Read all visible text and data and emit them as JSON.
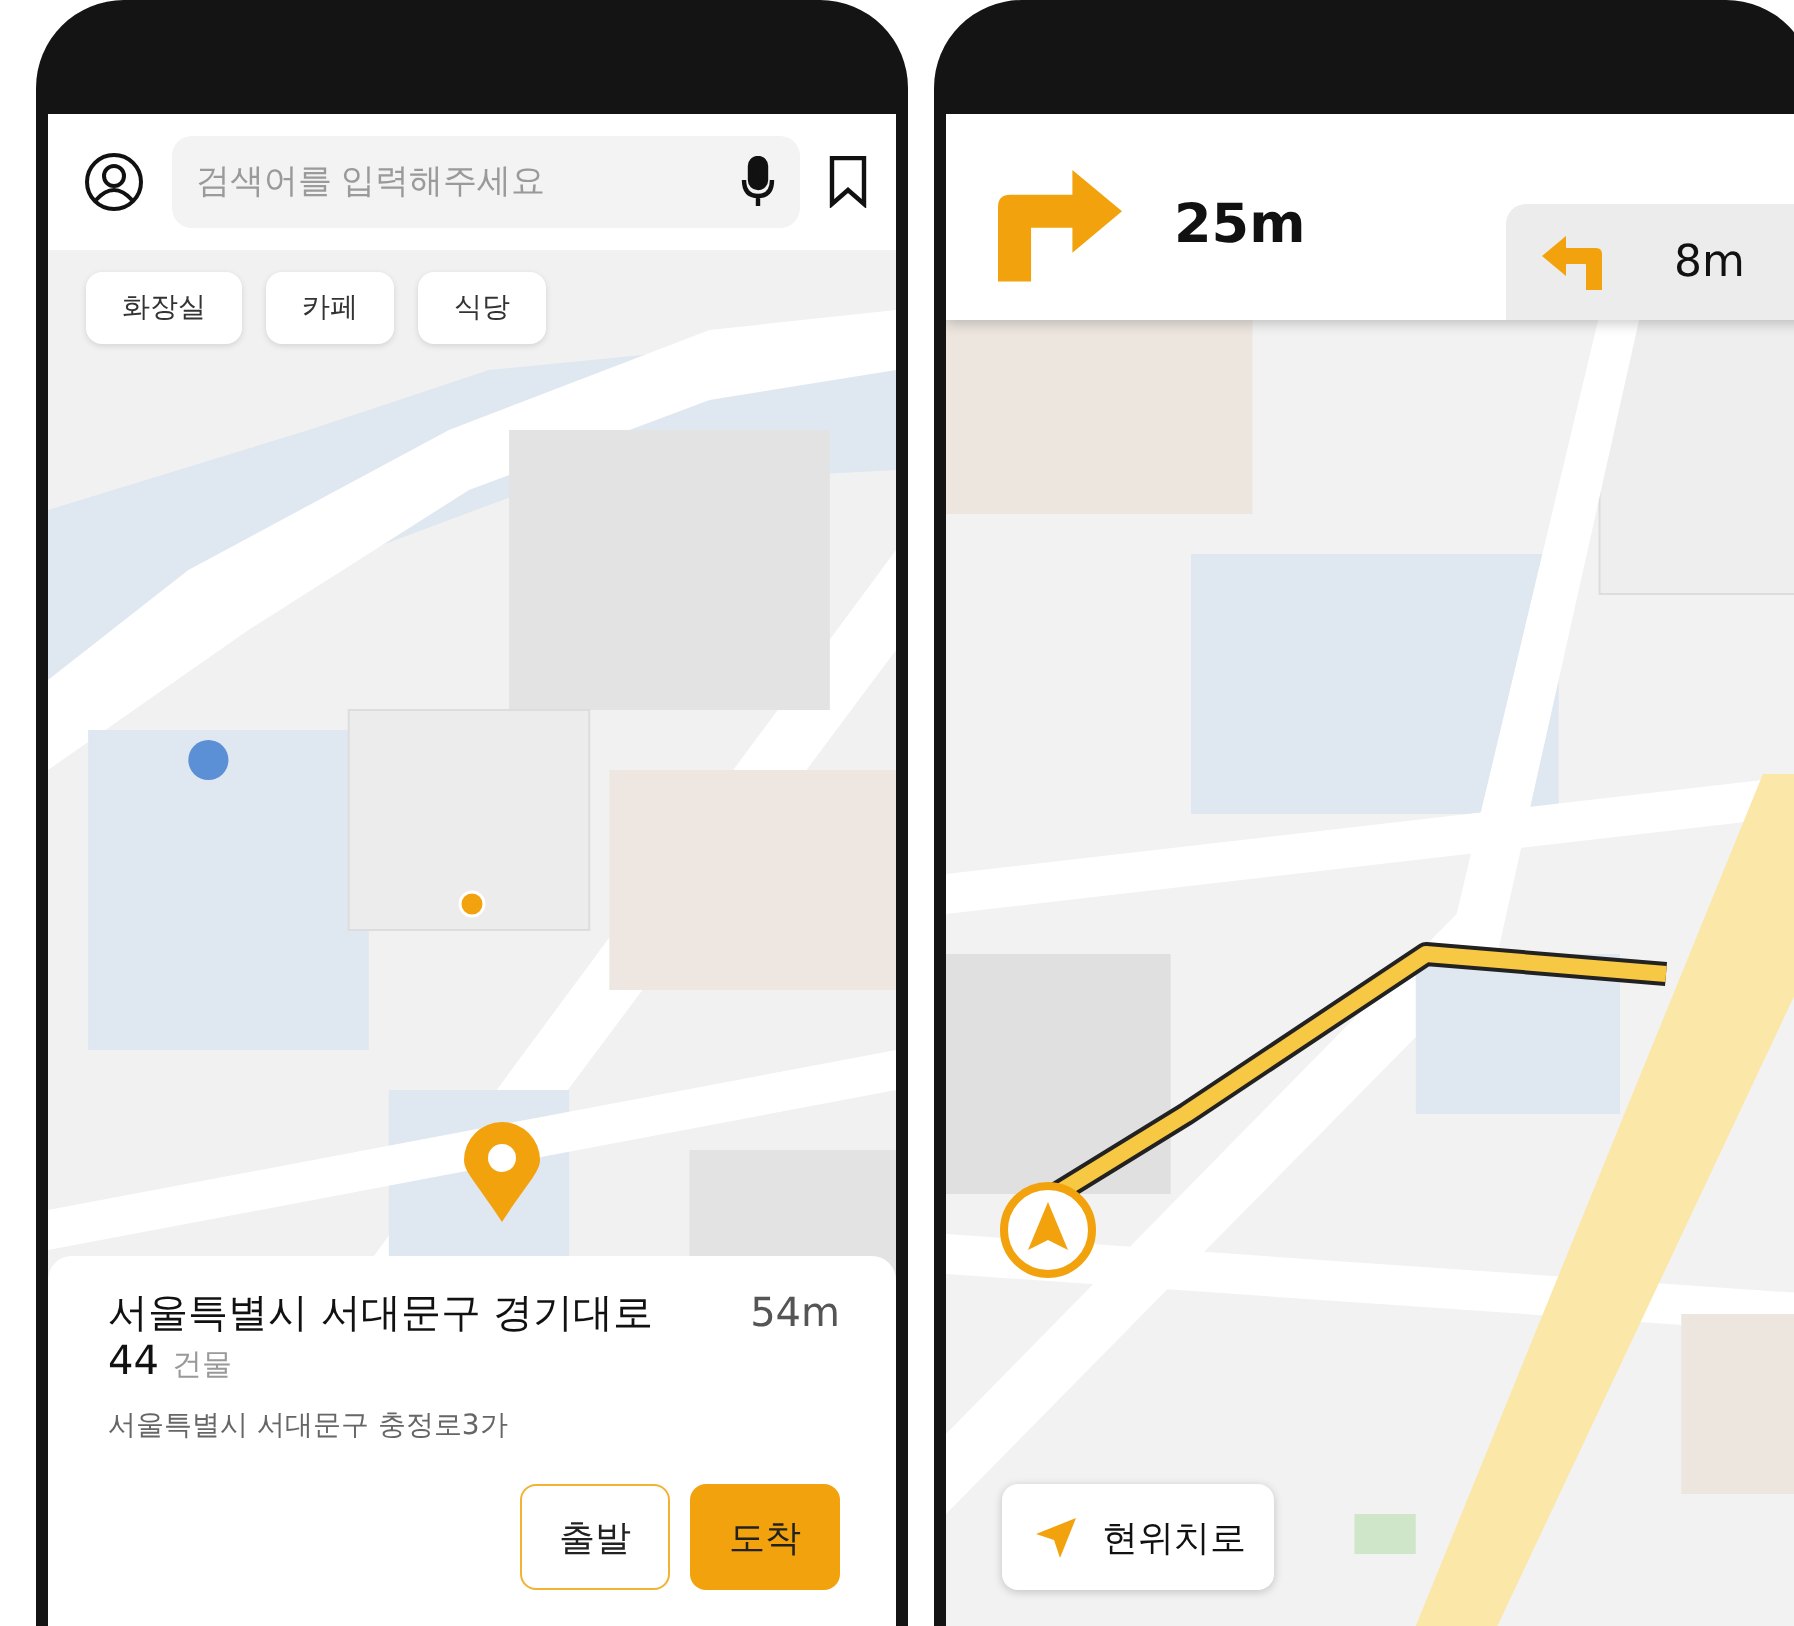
{
  "search_screen": {
    "search": {
      "placeholder": "검색어를 입력해주세요"
    },
    "chips": [
      {
        "label": "화장실"
      },
      {
        "label": "카페"
      },
      {
        "label": "식당"
      }
    ],
    "place": {
      "name": "서울특별시 서대문구 경기대로 44",
      "category": "건물",
      "distance": "54m",
      "address": "서울특별시 서대문구 충정로3가"
    },
    "buttons": [
      {
        "label": "출발",
        "kind": "outline"
      },
      {
        "label": "도착",
        "kind": "filled"
      }
    ]
  },
  "navigation_screen": {
    "next_turn": {
      "kind": "right",
      "distance": "25m"
    },
    "then_turn": {
      "kind": "left",
      "distance": "8m"
    },
    "locate_button": {
      "label": "현위치로"
    }
  }
}
